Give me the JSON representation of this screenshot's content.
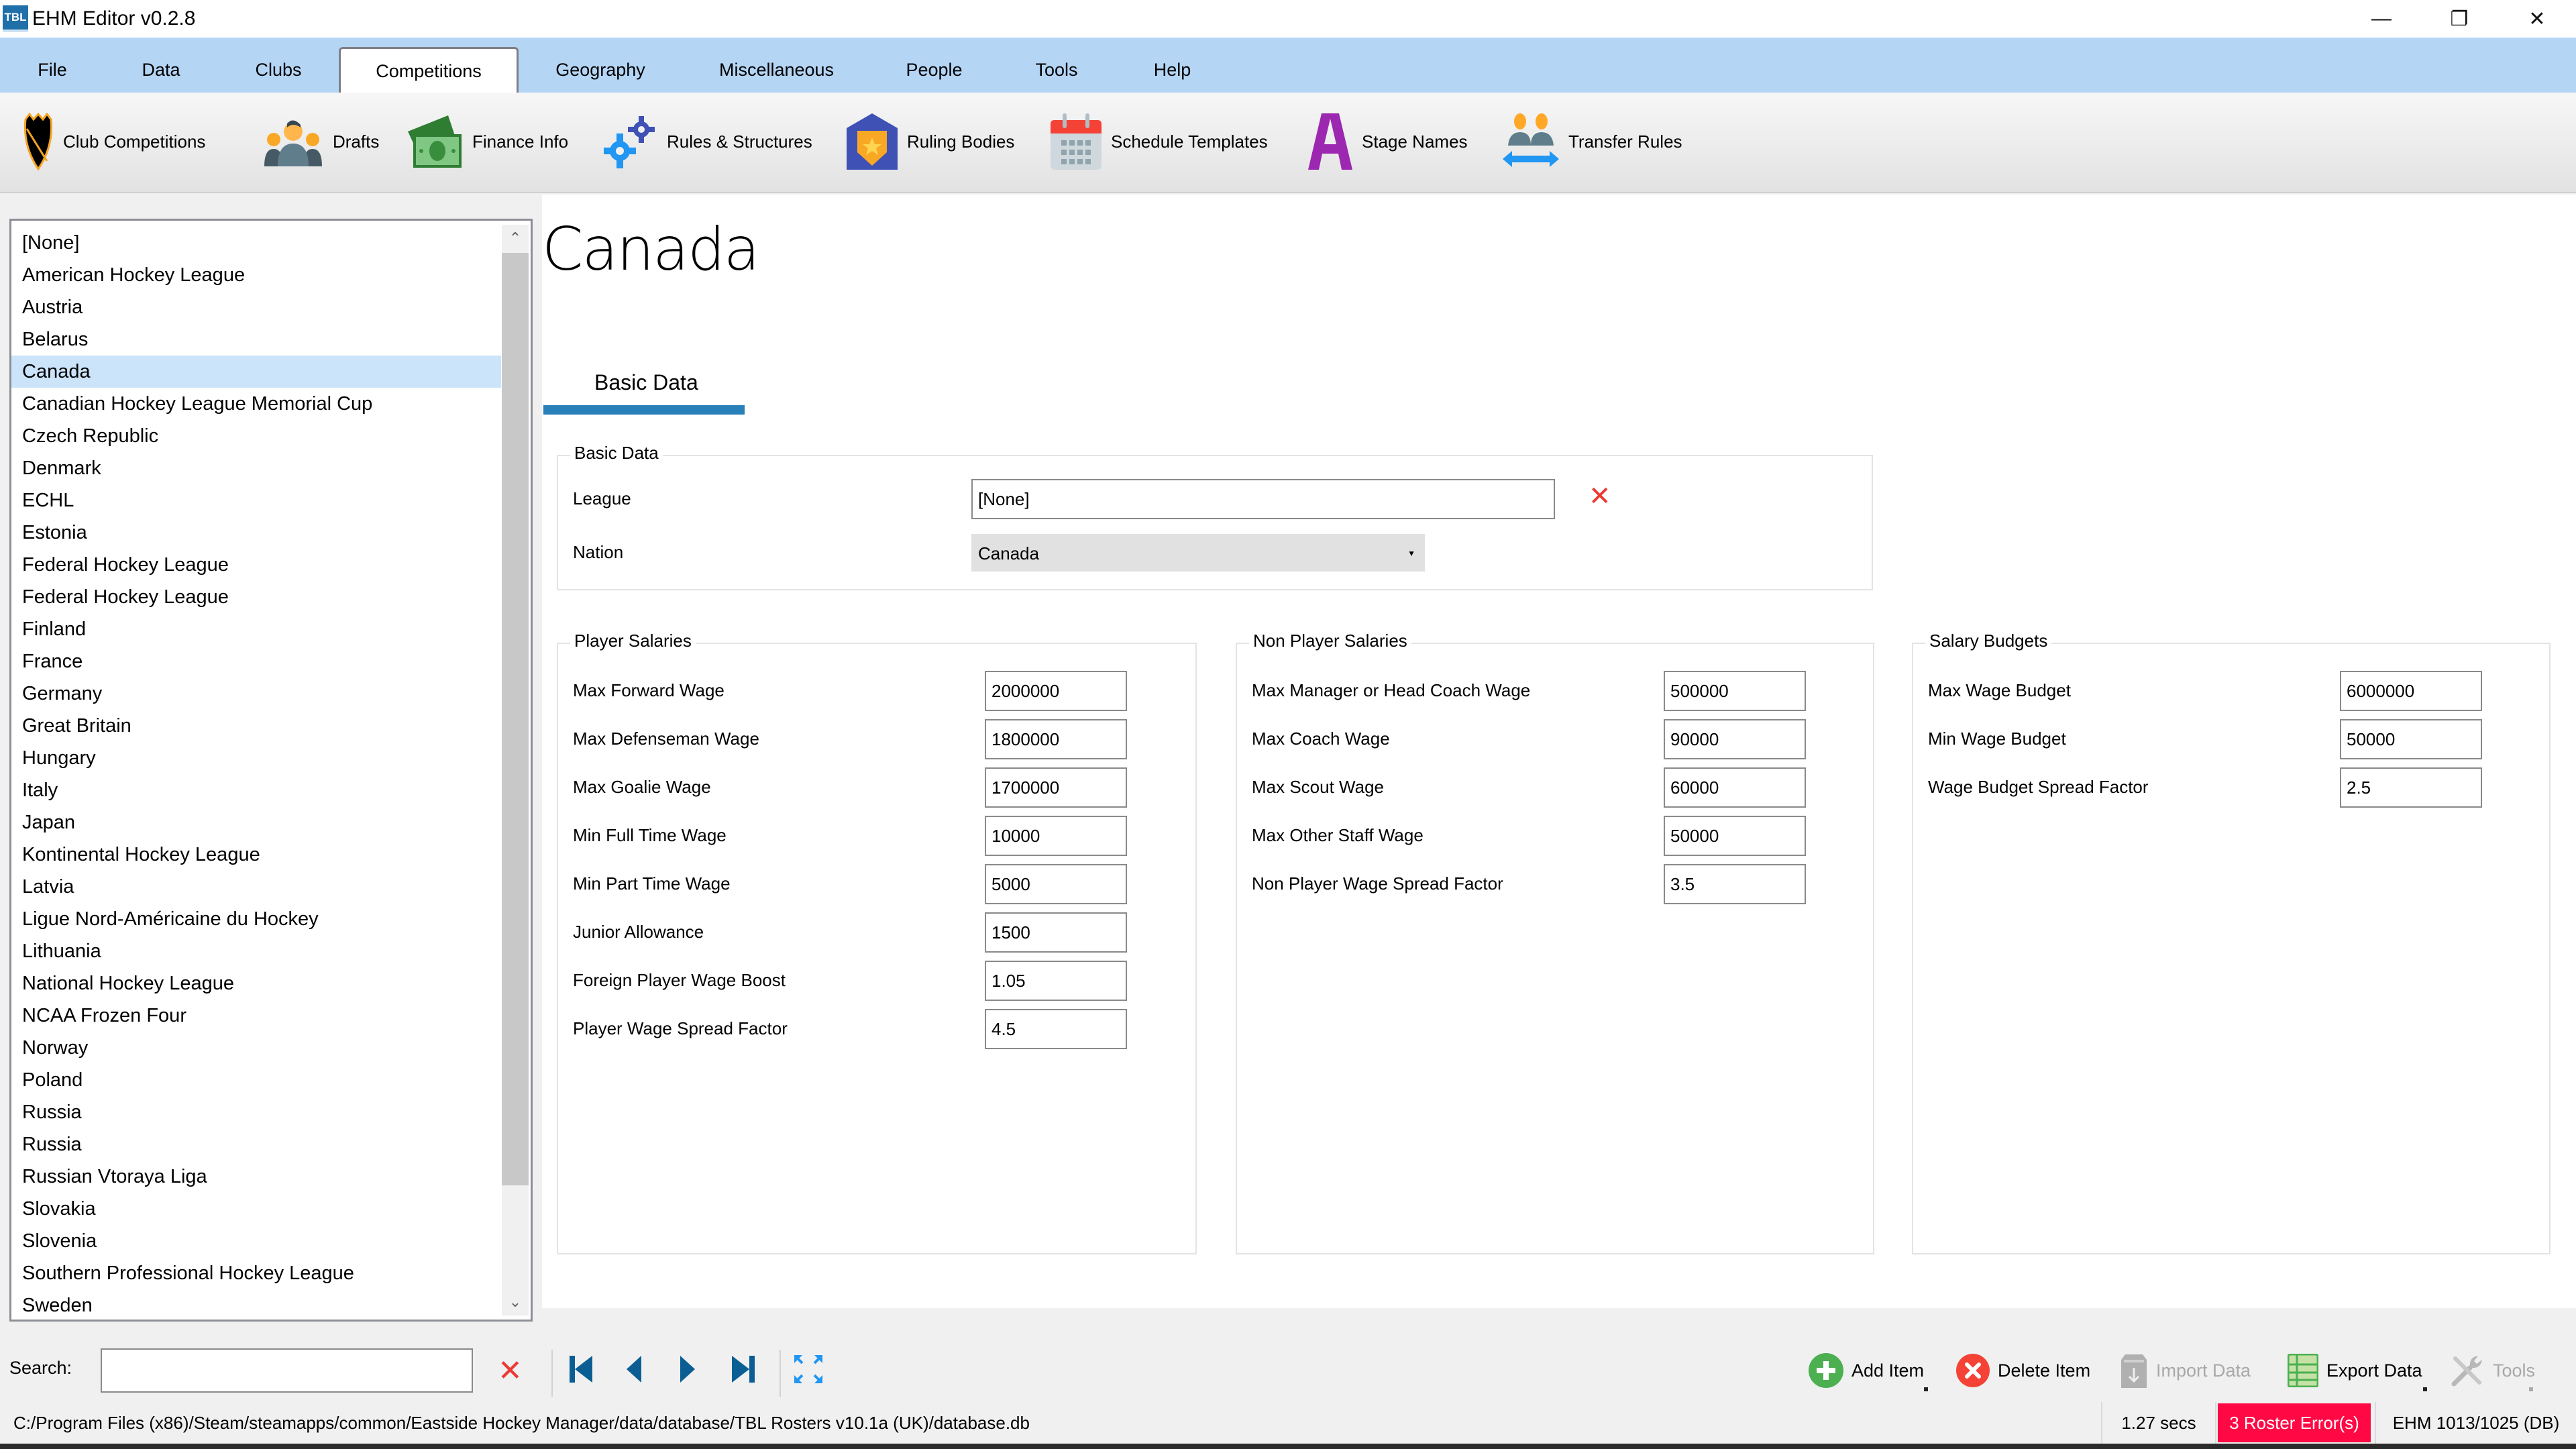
{
  "app": {
    "logo_text": "TBL",
    "title": "EHM Editor v0.2.8",
    "window_controls": {
      "minimize": "—",
      "restore": "❐",
      "close": "✕"
    }
  },
  "ribbon": {
    "tabs": [
      {
        "label": "File"
      },
      {
        "label": "Data"
      },
      {
        "label": "Clubs"
      },
      {
        "label": "Competitions",
        "active": true
      },
      {
        "label": "Geography"
      },
      {
        "label": "Miscellaneous"
      },
      {
        "label": "People"
      },
      {
        "label": "Tools"
      },
      {
        "label": "Help"
      }
    ]
  },
  "toolbar": {
    "items": [
      {
        "label": "Club Competitions",
        "icon": "shield-icon"
      },
      {
        "label": "Drafts",
        "icon": "people-icon"
      },
      {
        "label": "Finance Info",
        "icon": "money-icon"
      },
      {
        "label": "Rules & Structures",
        "icon": "gears-icon"
      },
      {
        "label": "Ruling Bodies",
        "icon": "badge-icon"
      },
      {
        "label": "Schedule Templates",
        "icon": "calendar-icon"
      },
      {
        "label": "Stage Names",
        "icon": "letter-a-icon"
      },
      {
        "label": "Transfer Rules",
        "icon": "transfer-icon"
      }
    ]
  },
  "list": {
    "selected": "Canada",
    "items": [
      "[None]",
      "American Hockey League",
      "Austria",
      "Belarus",
      "Canada",
      "Canadian Hockey League Memorial Cup",
      "Czech Republic",
      "Denmark",
      "ECHL",
      "Estonia",
      "Federal Hockey League",
      "Federal Hockey League",
      "Finland",
      "France",
      "Germany",
      "Great Britain",
      "Hungary",
      "Italy",
      "Japan",
      "Kontinental Hockey League",
      "Latvia",
      "Ligue Nord-Américaine du Hockey",
      "Lithuania",
      "National Hockey League",
      "NCAA Frozen Four",
      "Norway",
      "Poland",
      "Russia",
      "Russia",
      "Russian Vtoraya Liga",
      "Slovakia",
      "Slovenia",
      "Southern Professional Hockey League",
      "Sweden"
    ]
  },
  "detail": {
    "title": "Canada",
    "subtab": "Basic Data",
    "basic_data": {
      "group_title": "Basic Data",
      "league_label": "League",
      "league_value": "[None]",
      "nation_label": "Nation",
      "nation_value": "Canada",
      "clear_glyph": "✕"
    },
    "player_salaries": {
      "group_title": "Player Salaries",
      "fields": [
        {
          "label": "Max Forward Wage",
          "value": "2000000"
        },
        {
          "label": "Max Defenseman Wage",
          "value": "1800000"
        },
        {
          "label": "Max Goalie Wage",
          "value": "1700000"
        },
        {
          "label": "Min Full Time Wage",
          "value": "10000"
        },
        {
          "label": "Min Part Time Wage",
          "value": "5000"
        },
        {
          "label": "Junior Allowance",
          "value": "1500"
        },
        {
          "label": "Foreign Player Wage Boost",
          "value": "1.05"
        },
        {
          "label": "Player Wage Spread Factor",
          "value": "4.5"
        }
      ]
    },
    "non_player_salaries": {
      "group_title": "Non Player Salaries",
      "fields": [
        {
          "label": "Max Manager or Head Coach Wage",
          "value": "500000"
        },
        {
          "label": "Max Coach Wage",
          "value": "90000"
        },
        {
          "label": "Max Scout Wage",
          "value": "60000"
        },
        {
          "label": "Max Other Staff Wage",
          "value": "50000"
        },
        {
          "label": "Non Player Wage Spread Factor",
          "value": "3.5"
        }
      ]
    },
    "salary_budgets": {
      "group_title": "Salary Budgets",
      "fields": [
        {
          "label": "Max Wage Budget",
          "value": "6000000"
        },
        {
          "label": "Min Wage Budget",
          "value": "50000"
        },
        {
          "label": "Wage Budget Spread Factor",
          "value": "2.5"
        }
      ]
    }
  },
  "bottom": {
    "search_label": "Search:",
    "search_value": "",
    "search_clear": "✕",
    "actions": [
      {
        "label": "Add Item",
        "icon": "add-icon",
        "enabled": true
      },
      {
        "label": "Delete Item",
        "icon": "delete-icon",
        "enabled": true
      },
      {
        "label": "Import Data",
        "icon": "import-icon",
        "enabled": false
      },
      {
        "label": "Export Data",
        "icon": "spreadsheet-icon",
        "enabled": true
      },
      {
        "label": "Tools",
        "icon": "tools-icon",
        "enabled": false
      }
    ]
  },
  "status": {
    "path": "C:/Program Files (x86)/Steam/steamapps/common/Eastside Hockey Manager/data/database/TBL Rosters v10.1a (UK)/database.db",
    "time": "1.27 secs",
    "errors": "3 Roster Error(s)",
    "version": "EHM 1013/1025 (DB)"
  },
  "colors": {
    "ribbon_bg": "#b5d5f5",
    "selection": "#cce4fa",
    "accent": "#2980b9",
    "nav_blue": "#0b5e93",
    "error_bg": "#ff0844",
    "clear_red": "#ec3a33"
  }
}
